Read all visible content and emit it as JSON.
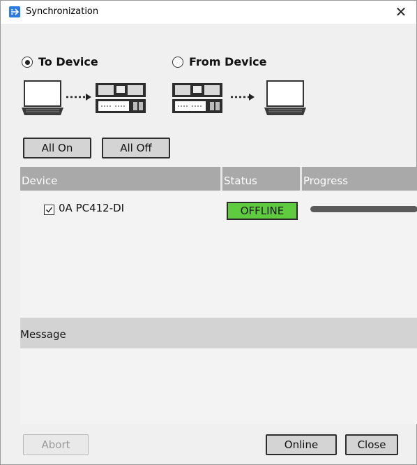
{
  "window": {
    "title": "Synchronization",
    "close_glyph": "✕"
  },
  "direction": {
    "to_device": {
      "label": "To Device",
      "selected": true
    },
    "from_device": {
      "label": "From Device",
      "selected": false
    }
  },
  "buttons": {
    "all_on": "All On",
    "all_off": "All Off"
  },
  "table": {
    "headers": {
      "device": "Device",
      "status": "Status",
      "progress": "Progress"
    },
    "rows": [
      {
        "device": "0A PC412-DI",
        "checked": true,
        "status": "OFFLINE",
        "status_color": "#5fcb3f",
        "progress": 1.0
      }
    ]
  },
  "message": {
    "label": "Message",
    "text": ""
  },
  "footer": {
    "abort": "Abort",
    "online": "Online",
    "close": "Close"
  },
  "icons": [
    "app-icon",
    "close-icon",
    "laptop-icon",
    "amplifier-icon",
    "arrow-right-icon",
    "checkbox-checked-icon"
  ]
}
